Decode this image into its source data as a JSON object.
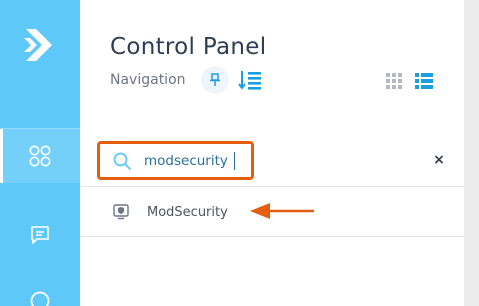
{
  "panel": {
    "title": "Control Panel",
    "subtitle": "Navigation"
  },
  "search": {
    "value": "modsecurity",
    "placeholder": "",
    "clear_label": "×"
  },
  "results": [
    {
      "label": "ModSecurity",
      "icon": "monitor-shield-icon"
    }
  ],
  "colors": {
    "rail": "#5ec8f8",
    "accent": "#1a9fe0",
    "highlight": "#e35f0e",
    "title": "#2c3e50"
  },
  "icons": {
    "logo": "double-chevron-logo-icon",
    "rail_items": [
      "grid-circles-icon",
      "chat-icon",
      "circle-icon"
    ],
    "pin": "pin-icon",
    "list_sort": "list-sort-icon",
    "grid_view": "grid-view-icon",
    "list_view": "list-view-icon",
    "search": "search-icon",
    "annotation": "arrow-left-icon"
  }
}
